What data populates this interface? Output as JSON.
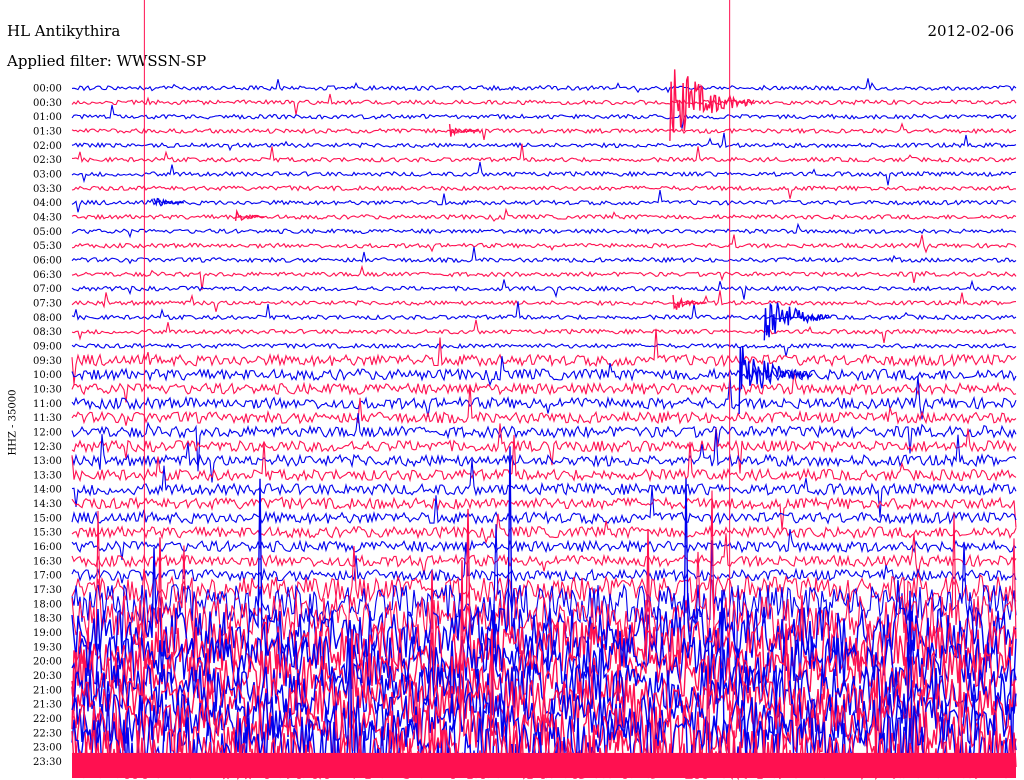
{
  "header": {
    "station": "HL Antikythira",
    "date": "2012-02-06",
    "filter_text": "Applied filter: WWSSN-SP"
  },
  "chart_data": {
    "type": "line",
    "title": "HL Antikythira",
    "subtitle": "Applied filter: WWSSN-SP",
    "ylabel": "HHZ - 35000",
    "rows": [
      "00:00",
      "00:30",
      "01:00",
      "01:30",
      "02:00",
      "02:30",
      "03:00",
      "03:30",
      "04:00",
      "04:30",
      "05:00",
      "05:30",
      "06:00",
      "06:30",
      "07:00",
      "07:30",
      "08:00",
      "08:30",
      "09:00",
      "09:30",
      "10:00",
      "10:30",
      "11:00",
      "11:30",
      "12:00",
      "12:30",
      "13:00",
      "13:30",
      "14:00",
      "14:30",
      "15:00",
      "15:30",
      "16:00",
      "16:30",
      "17:00",
      "17:30",
      "18:00",
      "18:30",
      "19:00",
      "19:30",
      "20:00",
      "20:30",
      "21:00",
      "21:30",
      "22:00",
      "22:30",
      "23:00",
      "23:30"
    ],
    "series_colors": [
      "#0000ee",
      "#ff1050"
    ],
    "noise_level": [
      1,
      1,
      1,
      1,
      1,
      1,
      1,
      1,
      1,
      1,
      1,
      1,
      1,
      1,
      1,
      1,
      1,
      1,
      1,
      2,
      3,
      3,
      3,
      3,
      3,
      3,
      3,
      3,
      3,
      3,
      3,
      3,
      3,
      3,
      3,
      4,
      6,
      7,
      8,
      8,
      8,
      8,
      8,
      8,
      8,
      9,
      10,
      10
    ],
    "events": [
      {
        "row": "00:30",
        "time_min": 19.0,
        "amplitude": 3.6
      },
      {
        "row": "01:30",
        "time_min": 12.0,
        "amplitude": 0.5
      },
      {
        "row": "04:00",
        "time_min": 2.6,
        "amplitude": 0.6
      },
      {
        "row": "04:30",
        "time_min": 5.2,
        "amplitude": 0.5
      },
      {
        "row": "07:30",
        "time_min": 19.1,
        "amplitude": 0.8
      },
      {
        "row": "08:00",
        "time_min": 22.0,
        "amplitude": 2.5
      },
      {
        "row": "10:00",
        "time_min": 21.2,
        "amplitude": 3.0
      }
    ],
    "markers": [
      {
        "time_min": 2.3,
        "color": "#ff1050"
      },
      {
        "time_min": 20.9,
        "color": "#ff1050"
      }
    ],
    "grid": false
  }
}
